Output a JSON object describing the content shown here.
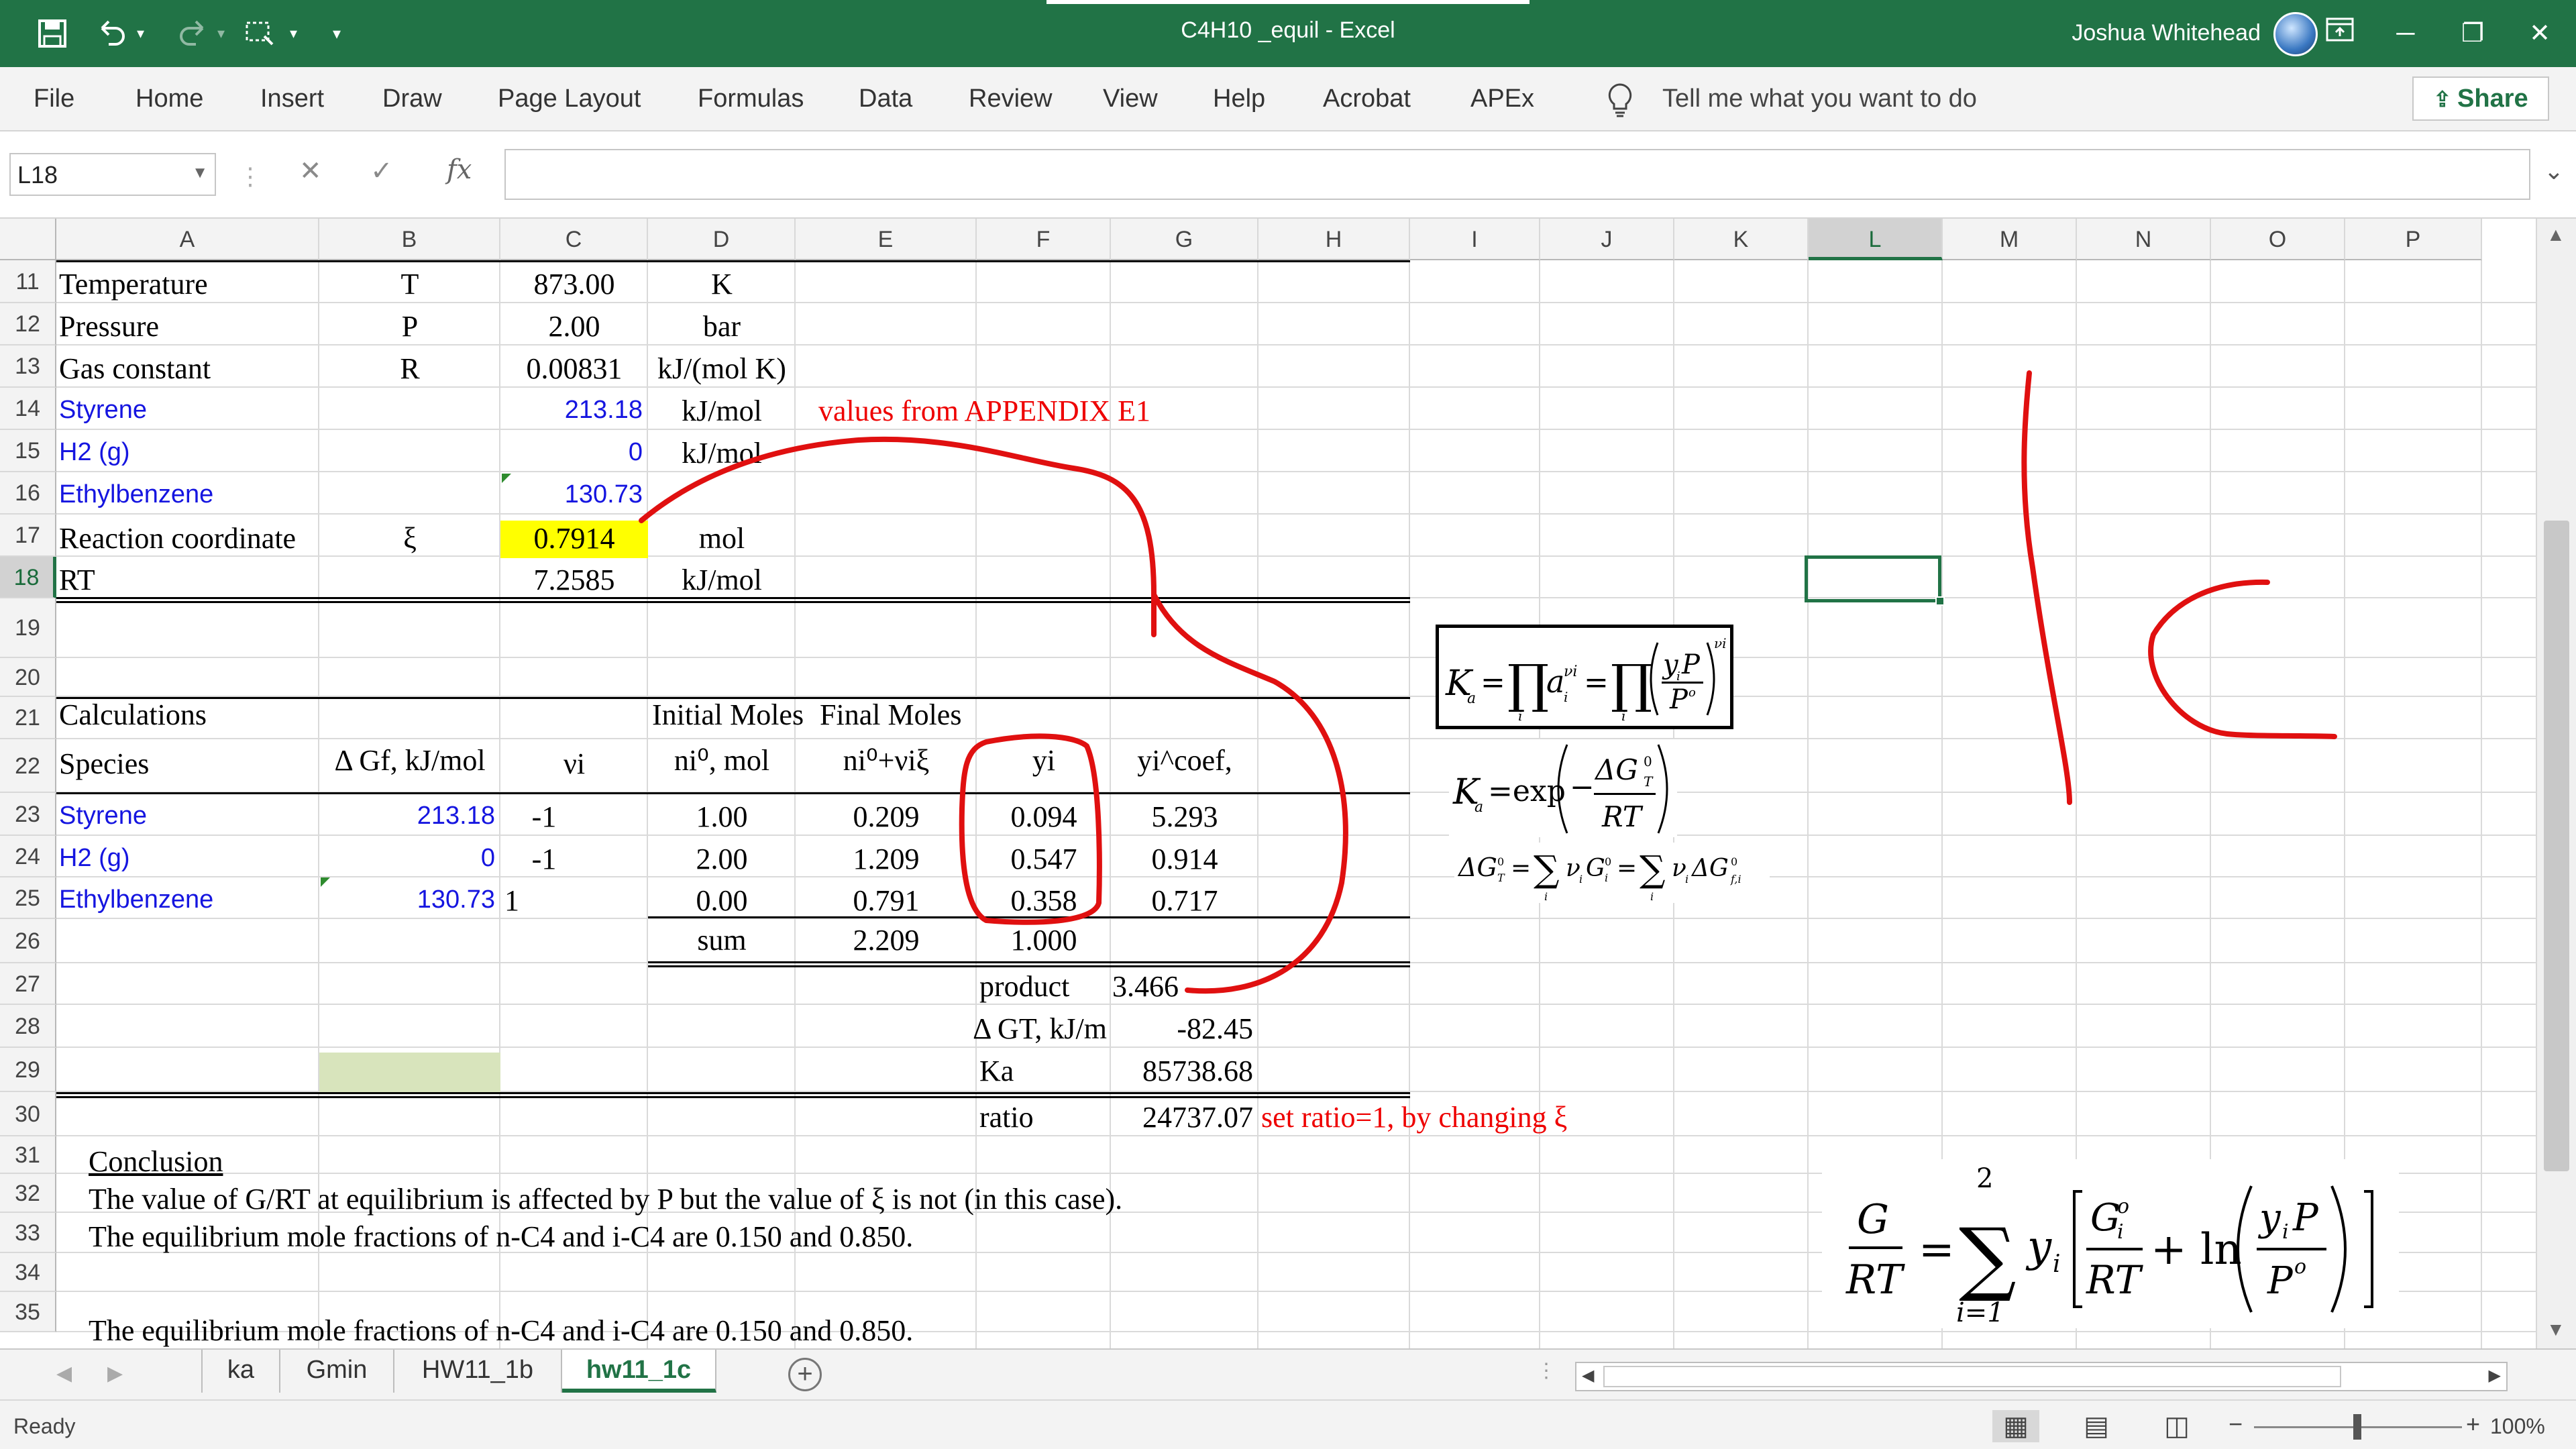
{
  "window": {
    "title": "C4H10 _equil  -  Excel",
    "user": "Joshua Whitehead",
    "share": "Share"
  },
  "ribbon": {
    "tabs": [
      "File",
      "Home",
      "Insert",
      "Draw",
      "Page Layout",
      "Formulas",
      "Data",
      "Review",
      "View",
      "Help",
      "Acrobat",
      "APEx"
    ],
    "tell_me": "Tell me what you want to do"
  },
  "formula_bar": {
    "name_box": "L18",
    "fx": "fx",
    "value": ""
  },
  "columns": [
    "A",
    "B",
    "C",
    "D",
    "E",
    "F",
    "G",
    "H",
    "I",
    "J",
    "K",
    "L",
    "M",
    "N",
    "O",
    "P"
  ],
  "selected_column": "L",
  "rows": [
    "11",
    "12",
    "13",
    "14",
    "15",
    "16",
    "17",
    "18",
    "19",
    "20",
    "21",
    "22",
    "23",
    "24",
    "25",
    "26",
    "27",
    "28",
    "29",
    "30",
    "31",
    "32",
    "33",
    "34",
    "35"
  ],
  "selected_row": "18",
  "cells": {
    "A11": "Temperature",
    "B11": "T",
    "C11": "873.00",
    "D11": "K",
    "A12": "Pressure",
    "B12": "P",
    "C12": "2.00",
    "D12": "bar",
    "A13": "Gas constant",
    "B13": "R",
    "C13": "0.00831",
    "D13": "kJ/(mol K)",
    "A14": "Styrene",
    "C14": "213.18",
    "D14": "kJ/mol",
    "E14": "values from APPENDIX E1",
    "A15": "H2 (g)",
    "C15": "0",
    "D15": "kJ/mol",
    "A16": "Ethylbenzene",
    "C16": "130.73",
    "A17": "Reaction coordinate",
    "B17": "ξ",
    "C17": "0.7914",
    "D17": "mol",
    "A18": "RT",
    "C18": "7.2585",
    "D18": "kJ/mol",
    "A21": "Calculations",
    "D21": "Initial Moles",
    "E21": "Final Moles",
    "A22": "Species",
    "B22": "Δ Gf, kJ/mol",
    "C22": "νi",
    "D22": "ni⁰, mol",
    "E22": "ni⁰+νiξ",
    "F22": "yi",
    "G22": "yi^coef,",
    "A23": "Styrene",
    "B23": "213.18",
    "C23": "-1",
    "D23": "1.00",
    "E23": "0.209",
    "F23": "0.094",
    "G23": "5.293",
    "A24": "H2 (g)",
    "B24": "0",
    "C24": "-1",
    "D24": "2.00",
    "E24": "1.209",
    "F24": "0.547",
    "G24": "0.914",
    "A25": "Ethylbenzene",
    "B25": "130.73",
    "C25": "1",
    "D25": "0.00",
    "E25": "0.791",
    "F25": "0.358",
    "G25": "0.717",
    "D26": "sum",
    "E26": "2.209",
    "F26": "1.000",
    "F27": "product",
    "G27": "3.466",
    "F28": "Δ GT, kJ/m",
    "G28": "-82.45",
    "F29": "Ka",
    "G29": "85738.68",
    "F30": "ratio",
    "G30": "24737.07",
    "H30": "set ratio=1, by changing ξ",
    "A31": "Conclusion",
    "A32": "The value of G/RT at equilibrium is affected by P but the value of ξ is not (in this case).",
    "A33": "The equilibrium mole fractions of n-C4 and i-C4 are 0.150 and 0.850.",
    "A35": "The equilibrium mole fractions of n-C4 and i-C4 are 0.150 and 0.850."
  },
  "sheets": [
    "ka",
    "Gmin",
    "HW11_1b",
    "hw11_1c"
  ],
  "active_sheet": "hw11_1c",
  "status": {
    "ready": "Ready",
    "zoom": "100%"
  },
  "colors": {
    "excel_green": "#217346",
    "highlight_yellow": "#ffff00",
    "input_green": "#d8e4bc",
    "ink_red": "#e01010",
    "blue_text": "#1515e0"
  }
}
